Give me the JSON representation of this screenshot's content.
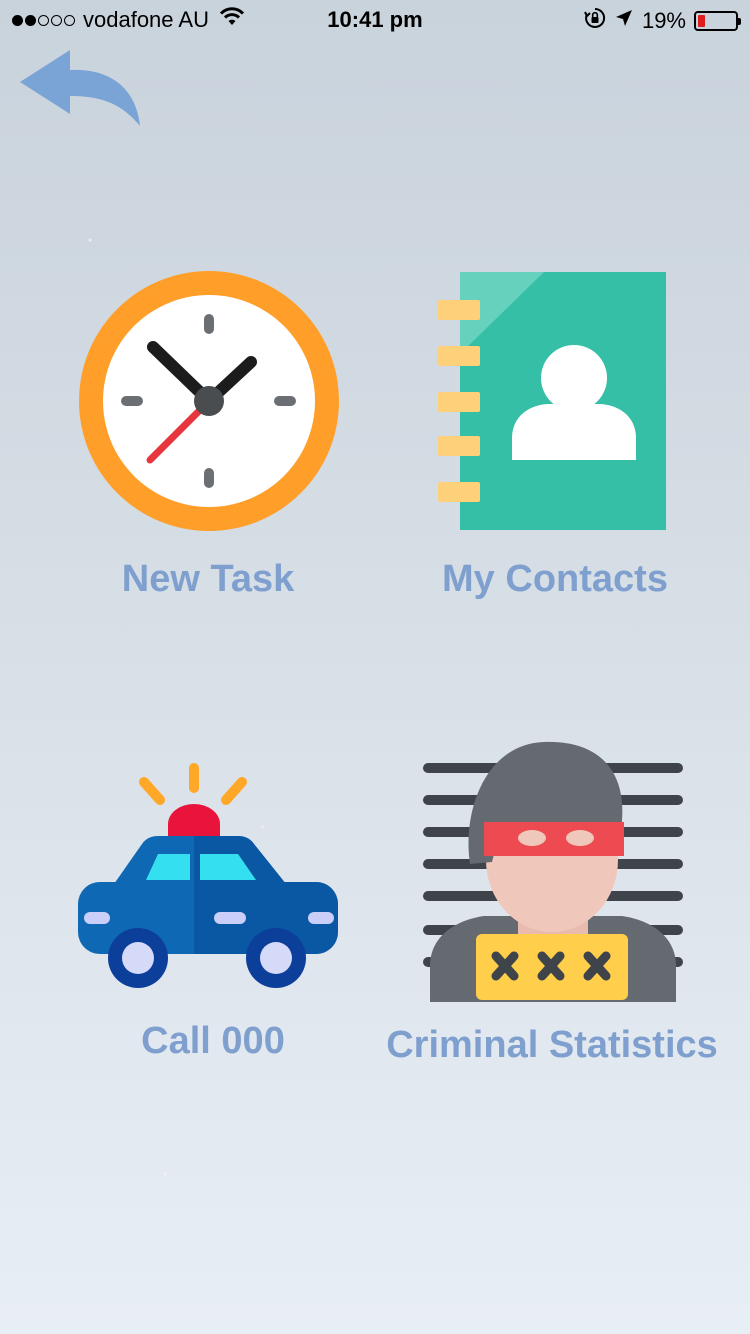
{
  "status_bar": {
    "signal_strength": 2,
    "signal_total": 5,
    "carrier": "vodafone AU",
    "time": "10:41 pm",
    "battery_percent": "19%",
    "battery_level": 0.19,
    "icons": [
      "wifi-icon",
      "orientation-lock-icon",
      "location-arrow-icon",
      "battery-icon"
    ]
  },
  "nav": {
    "back_icon": "back-arrow-icon"
  },
  "tiles": [
    {
      "label": "New Task",
      "icon": "clock-icon"
    },
    {
      "label": "My Contacts",
      "icon": "address-book-icon"
    },
    {
      "label": "Call 000",
      "icon": "police-car-icon"
    },
    {
      "label": "Criminal Statistics",
      "icon": "criminal-mugshot-icon"
    }
  ],
  "colors": {
    "label": "#7fa0cf",
    "back_arrow": "#7aa3d6",
    "clock_ring": "#ff9f2a",
    "contacts_green": "#35bfa6",
    "police_blue": "#0f68b4",
    "siren_red": "#e8143c",
    "mask_red": "#ee4a52",
    "sign_yellow": "#ffce4a"
  }
}
